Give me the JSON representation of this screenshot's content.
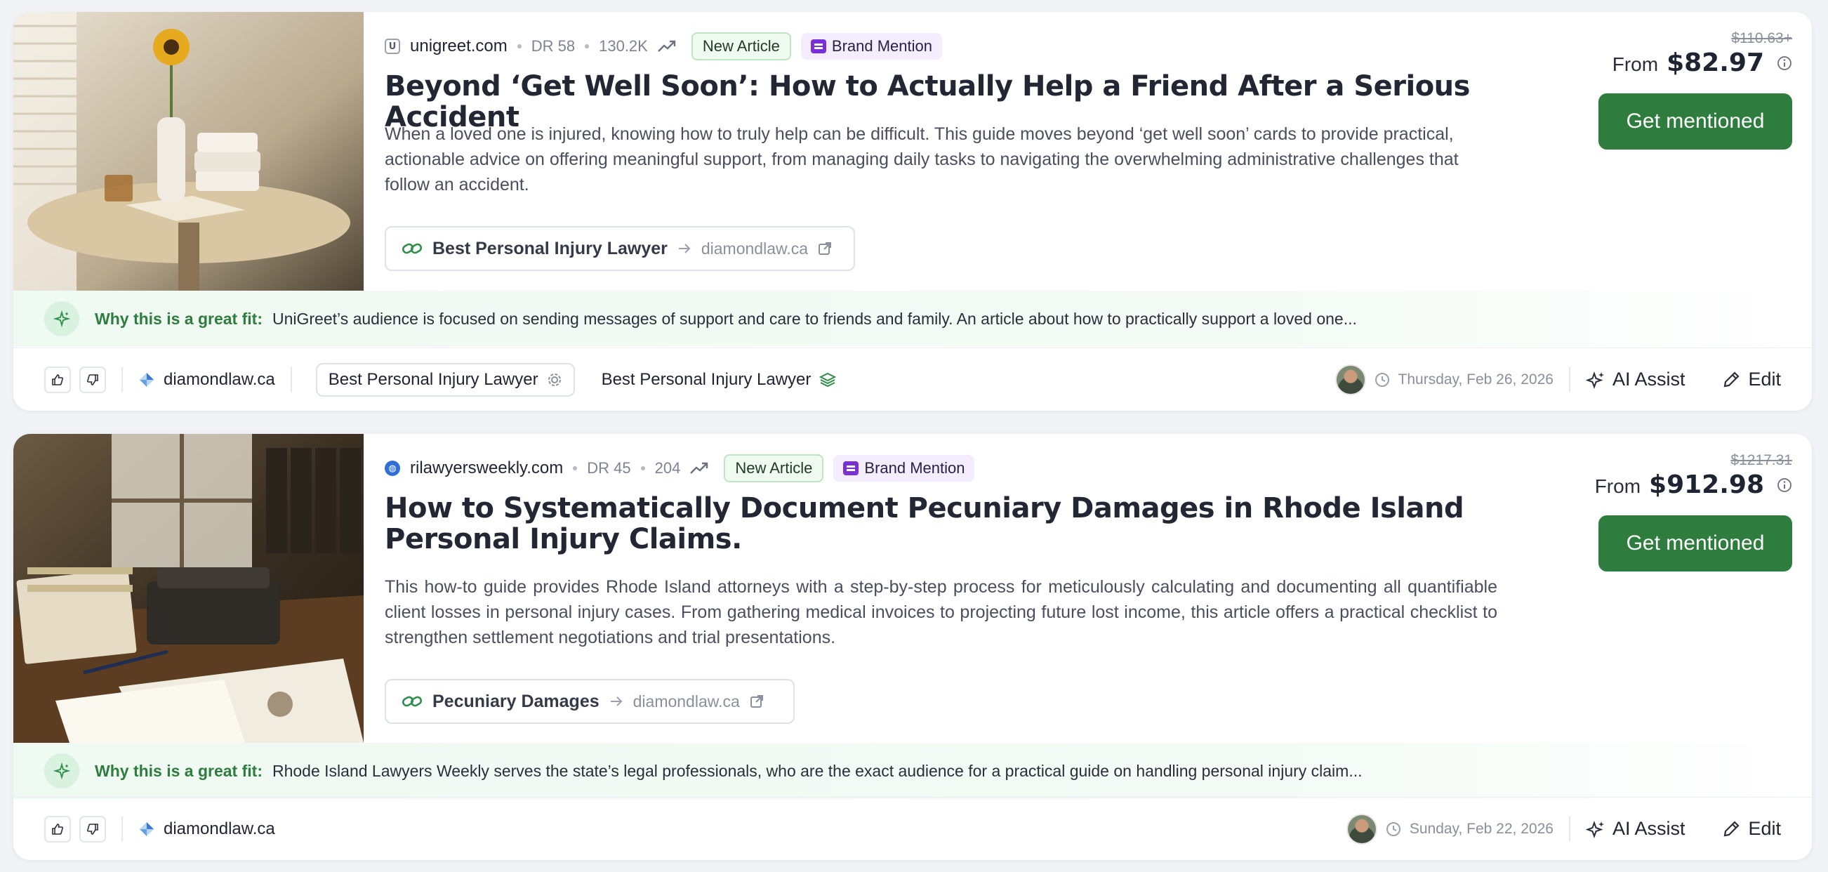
{
  "colors": {
    "primary_green": "#2f7d3e",
    "brand_purple": "#7b2fd6",
    "new_badge_bg": "#effaf1",
    "fit_bg": "#effaf2"
  },
  "cards": [
    {
      "site": {
        "favicon": "U",
        "domain": "unigreet.com",
        "dr": "DR 58",
        "traffic": "130.2K"
      },
      "badges": {
        "new": "New Article",
        "brand": "Brand Mention"
      },
      "title": "Beyond ‘Get Well Soon’: How to Actually Help a Friend After a Serious Accident",
      "description": "When a loved one is injured, knowing how to truly help can be difficult. This guide moves beyond ‘get well soon’ cards to provide practical, actionable advice on offering meaningful support, from managing daily tasks to navigating the overwhelming administrative challenges that follow an accident.",
      "link": {
        "anchor": "Best Personal Injury Lawyer",
        "target": "diamondlaw.ca"
      },
      "price": {
        "old": "$110.63+",
        "from_label": "From",
        "current": "$82.97"
      },
      "cta": "Get mentioned",
      "fit": {
        "label": "Why this is a great fit:",
        "text": "UniGreet’s audience is focused on sending messages of support and care to friends and family. An article about how to practically support a loved one..."
      },
      "footer": {
        "domain": "diamondlaw.ca",
        "keyword_chip": "Best Personal Injury Lawyer",
        "keyword_plain": "Best Personal Injury Lawyer",
        "date": "Thursday, Feb 26, 2026",
        "ai_assist": "AI Assist",
        "edit": "Edit"
      }
    },
    {
      "site": {
        "favicon": "globe",
        "domain": "rilawyersweekly.com",
        "dr": "DR 45",
        "traffic": "204"
      },
      "badges": {
        "new": "New Article",
        "brand": "Brand Mention"
      },
      "title": "How to Systematically Document Pecuniary Damages in Rhode Island Personal Injury Claims.",
      "description": "This how-to guide provides Rhode Island attorneys with a step-by-step process for meticulously calculating and documenting all quantifiable client losses in personal injury cases. From gathering medical invoices to projecting future lost income, this article offers a practical checklist to strengthen settlement negotiations and trial presentations.",
      "link": {
        "anchor": "Pecuniary Damages",
        "target": "diamondlaw.ca"
      },
      "price": {
        "old": "$1217.31",
        "from_label": "From",
        "current": "$912.98"
      },
      "cta": "Get mentioned",
      "fit": {
        "label": "Why this is a great fit:",
        "text": "Rhode Island Lawyers Weekly serves the state’s legal professionals, who are the exact audience for a practical guide on handling personal injury claim..."
      },
      "footer": {
        "domain": "diamondlaw.ca",
        "date": "Sunday, Feb 22, 2026",
        "ai_assist": "AI Assist",
        "edit": "Edit"
      }
    }
  ]
}
